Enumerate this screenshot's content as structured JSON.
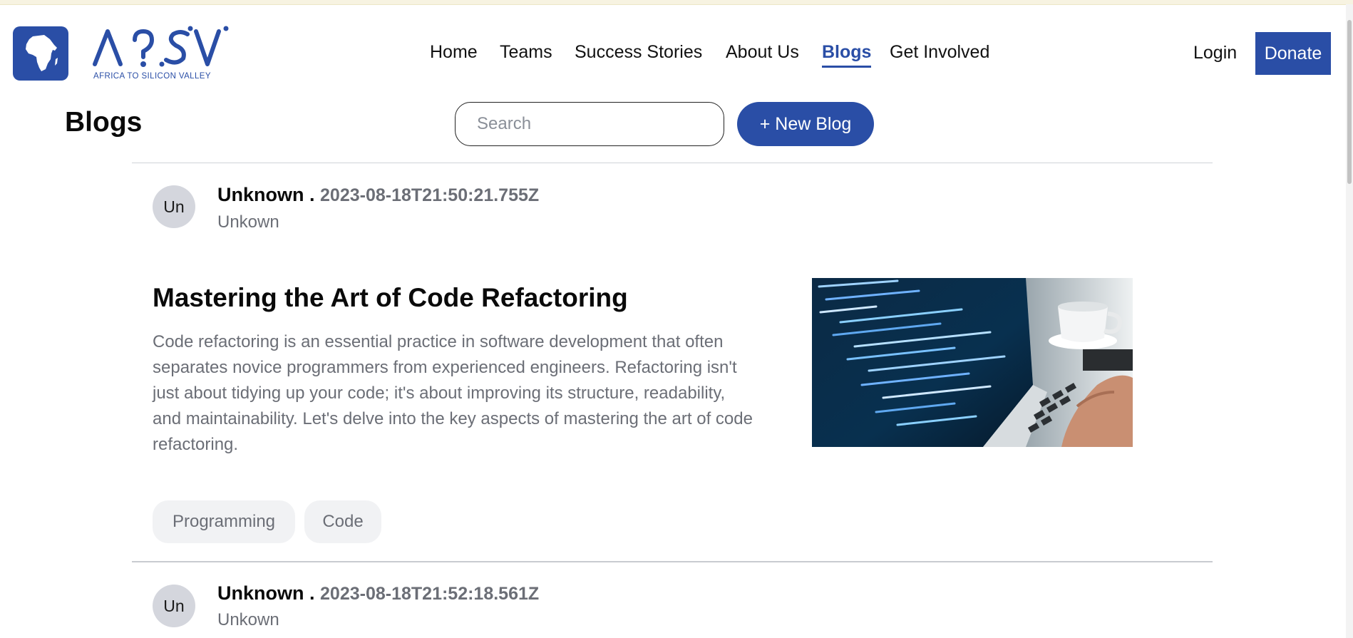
{
  "brand": {
    "name": "A2SV",
    "tagline": "AFRICA TO SILICON VALLEY",
    "primary_color": "#2a4ea6"
  },
  "nav": {
    "items": [
      {
        "label": "Home",
        "active": false
      },
      {
        "label": "Teams",
        "active": false
      },
      {
        "label": "Success Stories",
        "active": false
      },
      {
        "label": "About Us",
        "active": false
      },
      {
        "label": "Blogs",
        "active": true
      },
      {
        "label": "Get Involved",
        "active": false
      }
    ],
    "login_label": "Login",
    "donate_label": "Donate"
  },
  "page": {
    "title": "Blogs",
    "search_placeholder": "Search",
    "new_blog_label": "+ New Blog"
  },
  "posts": [
    {
      "avatar_initials": "Un",
      "author": "Unknown .",
      "date": "2023-08-18T21:50:21.755Z",
      "role": "Unkown",
      "title": "Mastering the Art of Code Refactoring",
      "excerpt": "Code refactoring is an essential practice in software development that often separates novice programmers from experienced engineers. Refactoring isn't just about tidying up your code; it's about improving its structure, readability, and maintainability. Let's delve into the key aspects of mastering the art of code refactoring.",
      "image": "laptop-code-photo",
      "tags": [
        "Programming",
        "Code"
      ]
    },
    {
      "avatar_initials": "Un",
      "author": "Unknown .",
      "date": "2023-08-18T21:52:18.561Z",
      "role": "Unkown"
    }
  ]
}
